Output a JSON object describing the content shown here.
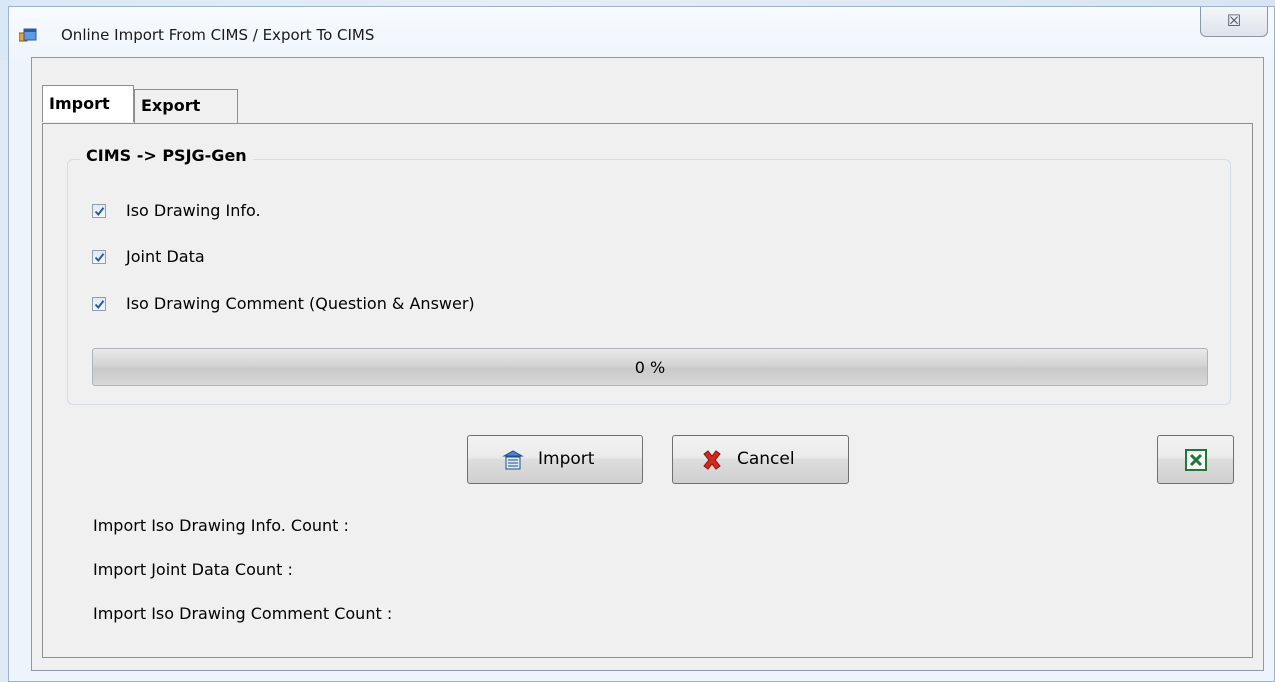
{
  "window": {
    "title": "Online Import From CIMS / Export To CIMS",
    "close_glyph": "☒"
  },
  "tabs": [
    {
      "label": "Import",
      "active": true
    },
    {
      "label": "Export",
      "active": false
    }
  ],
  "group": {
    "title": "CIMS -> PSJG-Gen",
    "options": [
      {
        "label": "Iso Drawing Info.",
        "checked": true
      },
      {
        "label": "Joint Data",
        "checked": true
      },
      {
        "label": "Iso Drawing Comment (Question & Answer)",
        "checked": true
      }
    ],
    "progress": {
      "value": 0,
      "text": "0 %"
    }
  },
  "buttons": {
    "import_label": "Import",
    "cancel_label": "Cancel",
    "excel_icon": "excel-icon"
  },
  "counts": {
    "iso_drawing_info": "Import Iso Drawing Info. Count :",
    "joint_data": "Import Joint Data Count :",
    "iso_drawing_comment": "Import Iso Drawing Comment Count :"
  },
  "colors": {
    "checkmark": "#2b5aa8",
    "cancel_x": "#d4281c",
    "excel_green": "#1d7a36"
  }
}
